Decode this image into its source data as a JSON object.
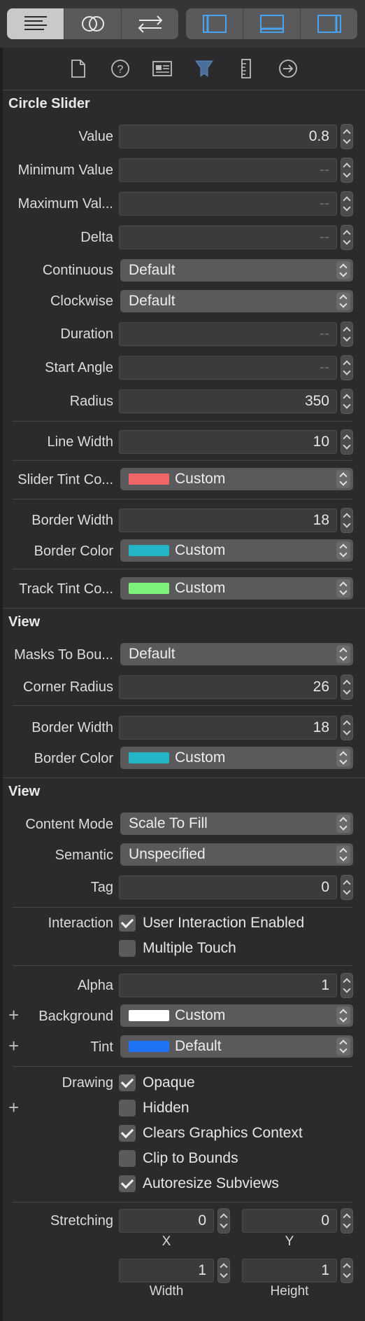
{
  "toolbar": {
    "left_segment": [
      "lines-icon",
      "circles-icon",
      "arrows-icon"
    ],
    "right_segment": [
      "left-panel-icon",
      "bottom-panel-icon",
      "right-panel-icon"
    ]
  },
  "inspector_tabs": [
    "file-icon",
    "help-icon",
    "identity-icon",
    "attributes-icon",
    "ruler-icon",
    "connections-icon"
  ],
  "circle_slider": {
    "title": "Circle Slider",
    "value_label": "Value",
    "value": "0.8",
    "min_label": "Minimum Value",
    "min": "--",
    "max_label": "Maximum Val...",
    "max": "--",
    "delta_label": "Delta",
    "delta": "--",
    "continuous_label": "Continuous",
    "continuous": "Default",
    "clockwise_label": "Clockwise",
    "clockwise": "Default",
    "duration_label": "Duration",
    "duration": "--",
    "start_angle_label": "Start Angle",
    "start_angle": "--",
    "radius_label": "Radius",
    "radius": "350",
    "line_width_label": "Line Width",
    "line_width": "10",
    "slider_tint_label": "Slider Tint Co...",
    "slider_tint": "Custom",
    "slider_tint_color": "#f16565",
    "border_width_label": "Border Width",
    "border_width": "18",
    "border_color_label": "Border Color",
    "border_color": "Custom",
    "border_color_color": "#23b4c6",
    "track_tint_label": "Track Tint Co...",
    "track_tint": "Custom",
    "track_tint_color": "#7ef27a"
  },
  "view1": {
    "title": "View",
    "masks_label": "Masks To Bou...",
    "masks": "Default",
    "corner_radius_label": "Corner Radius",
    "corner_radius": "26",
    "border_width_label": "Border Width",
    "border_width": "18",
    "border_color_label": "Border Color",
    "border_color": "Custom",
    "border_color_color": "#23b4c6"
  },
  "view2": {
    "title": "View",
    "content_mode_label": "Content Mode",
    "content_mode": "Scale To Fill",
    "semantic_label": "Semantic",
    "semantic": "Unspecified",
    "tag_label": "Tag",
    "tag": "0",
    "interaction_label": "Interaction",
    "user_interaction": "User Interaction Enabled",
    "multiple_touch": "Multiple Touch",
    "alpha_label": "Alpha",
    "alpha": "1",
    "plus": "+",
    "background_label": "Background",
    "background": "Custom",
    "background_color": "#ffffff",
    "tint_label": "Tint",
    "tint": "Default",
    "tint_color": "#1f74f3",
    "drawing_label": "Drawing",
    "opaque": "Opaque",
    "hidden": "Hidden",
    "clears": "Clears Graphics Context",
    "clip": "Clip to Bounds",
    "autoresize": "Autoresize Subviews",
    "stretching_label": "Stretching",
    "x_value": "0",
    "x_label": "X",
    "y_value": "0",
    "y_label": "Y",
    "width_value": "1",
    "width_label": "Width",
    "height_value": "1",
    "height_label": "Height"
  }
}
